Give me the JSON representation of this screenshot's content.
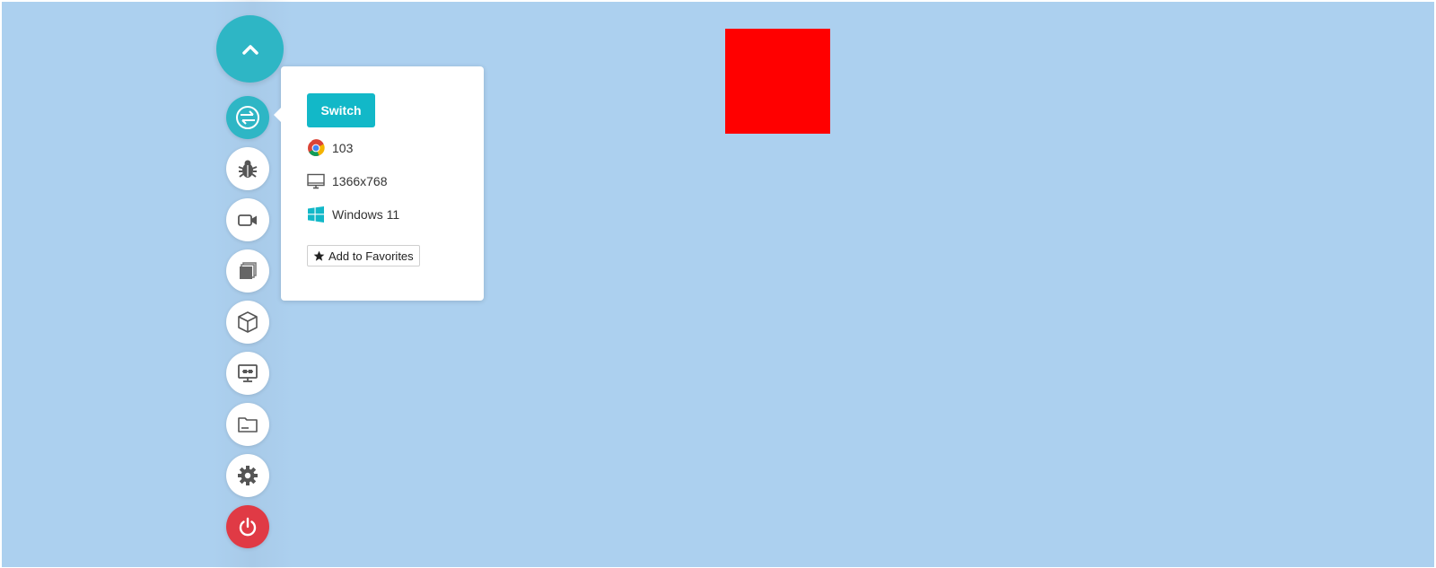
{
  "toolbar": {
    "collapse_icon": "chevron-up-icon",
    "items": [
      {
        "name": "switch-browser",
        "icon": "browser-switch-icon",
        "active": true
      },
      {
        "name": "bug-report",
        "icon": "bug-icon"
      },
      {
        "name": "record-video",
        "icon": "video-camera-icon"
      },
      {
        "name": "screenshots",
        "icon": "gallery-icon"
      },
      {
        "name": "extensions",
        "icon": "cube-icon"
      },
      {
        "name": "remote-display",
        "icon": "monitor-icon"
      },
      {
        "name": "file-manager",
        "icon": "folder-icon"
      },
      {
        "name": "settings",
        "icon": "gear-icon"
      },
      {
        "name": "end-session",
        "icon": "power-icon"
      }
    ]
  },
  "popover": {
    "switch_label": "Switch",
    "browser_version": "103",
    "browser_icon": "chrome-icon",
    "resolution": "1366x768",
    "resolution_icon": "monitor-icon",
    "os": "Windows 11",
    "os_icon": "windows-logo-icon",
    "favorite_label": "Add to Favorites",
    "favorite_icon": "star-icon"
  },
  "colors": {
    "background": "#acd0ef",
    "accent": "#12b8c8",
    "toolbar_teal": "#2eb6c5",
    "danger": "#e03a45",
    "square": "#ff0000"
  }
}
